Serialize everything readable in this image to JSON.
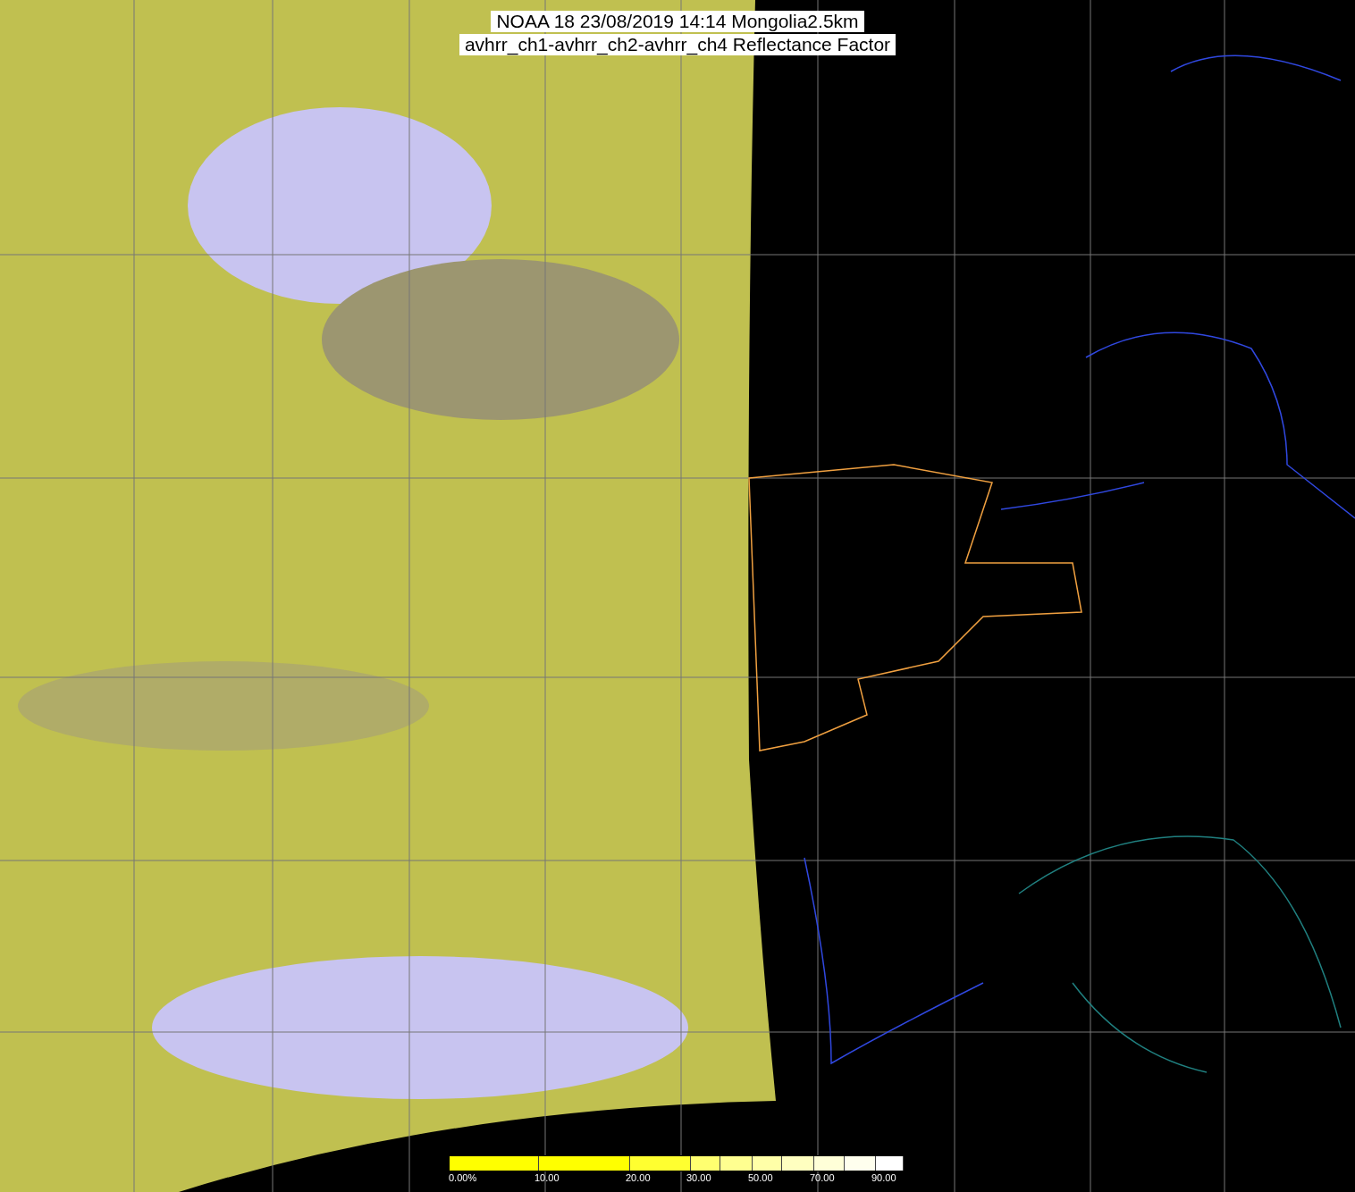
{
  "title": {
    "line_1": "NOAA 18 23/08/2019 14:14 Mongolia2.5km",
    "line_2": "avhrr_ch1-avhrr_ch2-avhrr_ch4 Reflectance Factor"
  },
  "colorbar": {
    "segments": [
      {
        "color": "#ffff00",
        "label": "0.00%"
      },
      {
        "color": "#ffff00",
        "label": "10.00"
      },
      {
        "color": "#ffff30",
        "label": "20.00"
      },
      {
        "color": "#ffff70",
        "label": "30.00"
      },
      {
        "color": "#ffff90"
      },
      {
        "color": "#ffffa8",
        "label": "50.00"
      },
      {
        "color": "#ffffc0"
      },
      {
        "color": "#ffffd8",
        "label": "70.00"
      },
      {
        "color": "#ffffee"
      },
      {
        "color": "#ffffff",
        "label": "90.00"
      }
    ]
  }
}
